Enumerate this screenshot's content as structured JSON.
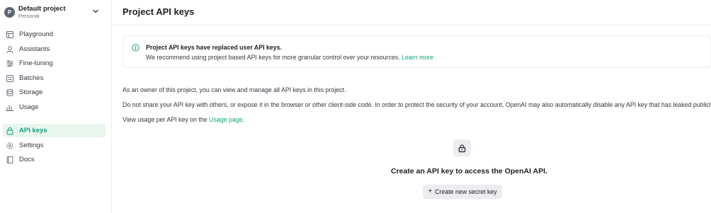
{
  "project": {
    "avatar_letter": "P",
    "name": "Default project",
    "subtitle": "Personal"
  },
  "sidebar": {
    "items": [
      {
        "label": "Playground",
        "icon": "playground-icon"
      },
      {
        "label": "Assistants",
        "icon": "assistants-icon"
      },
      {
        "label": "Fine-tuning",
        "icon": "fine-tuning-icon"
      },
      {
        "label": "Batches",
        "icon": "batches-icon"
      },
      {
        "label": "Storage",
        "icon": "storage-icon"
      },
      {
        "label": "Usage",
        "icon": "usage-icon"
      },
      {
        "label": "API keys",
        "icon": "lock-icon",
        "active": true
      },
      {
        "label": "Settings",
        "icon": "gear-icon"
      },
      {
        "label": "Docs",
        "icon": "docs-icon"
      }
    ]
  },
  "main": {
    "title": "Project API keys",
    "notice": {
      "title": "Project API keys have replaced user API keys.",
      "body": "We recommend using project based API keys for more granular control over your resources.",
      "link": "Learn more"
    },
    "para1": "As an owner of this project, you can view and manage all API keys in this project.",
    "para2": "Do not share your API key with others, or expose it in the browser or other client-side code. In order to protect the security of your account, OpenAI may also automatically disable any API key that has leaked publicly.",
    "para3_prefix": "View usage per API key on the",
    "para3_link": "Usage page",
    "para3_suffix": ".",
    "empty_title": "Create an API key to access the OpenAI API.",
    "create_button": "Create new secret key"
  },
  "colors": {
    "accent": "#10a37f",
    "active_bg": "#e9f6ee",
    "border": "#ececf1"
  }
}
